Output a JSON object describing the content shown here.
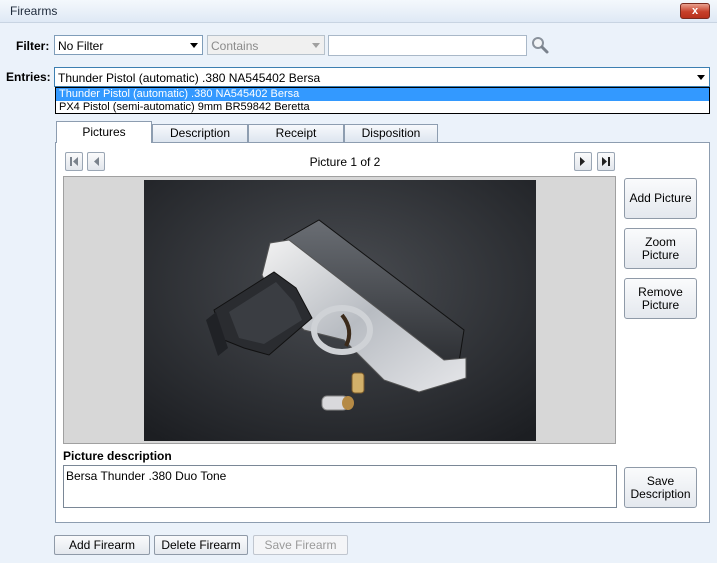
{
  "window": {
    "title": "Firearms",
    "close_glyph": "x"
  },
  "filter": {
    "label": "Filter:",
    "field_value": "No Filter",
    "operator_value": "Contains",
    "text_value": ""
  },
  "entries": {
    "label": "Entries:",
    "selected": "Thunder Pistol (automatic) .380 NA545402 Bersa",
    "options": [
      "Thunder Pistol (automatic) .380 NA545402 Bersa",
      "PX4 Pistol (semi-automatic) 9mm BR59842 Beretta"
    ]
  },
  "tabs": [
    "Pictures",
    "Description",
    "Receipt",
    "Disposition"
  ],
  "pictures": {
    "counter": "Picture 1 of 2",
    "add_line1": "Add Picture",
    "zoom_line1": "Zoom",
    "zoom_line2": "Picture",
    "remove_line1": "Remove",
    "remove_line2": "Picture",
    "desc_label": "Picture description",
    "desc_value": "Bersa Thunder .380 Duo Tone",
    "save_line1": "Save",
    "save_line2": "Description"
  },
  "footer": {
    "add": "Add Firearm",
    "delete": "Delete Firearm",
    "save": "Save Firearm"
  },
  "icons": {
    "first": "first-page-icon",
    "prev": "previous-page-icon",
    "next": "next-page-icon",
    "last": "last-page-icon",
    "search": "search-icon"
  },
  "colors": {
    "selection": "#3399ff",
    "close": "#c7402a"
  }
}
